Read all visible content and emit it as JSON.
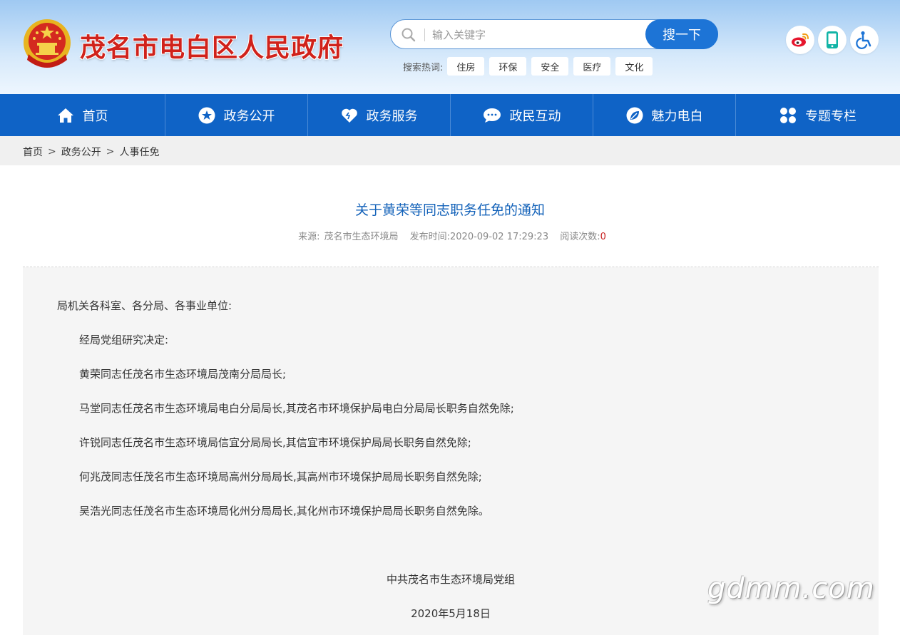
{
  "header": {
    "site_title": "茂名市电白区人民政府",
    "emblem_icon": "national-emblem-icon",
    "search": {
      "placeholder": "输入关键字",
      "button_label": "搜一下"
    },
    "hot_search": {
      "label": "搜索热词:",
      "tags": [
        "住房",
        "环保",
        "安全",
        "医疗",
        "文化"
      ]
    },
    "tools": [
      {
        "icon": "weibo-icon"
      },
      {
        "icon": "mobile-icon"
      },
      {
        "icon": "accessibility-icon"
      }
    ]
  },
  "nav": {
    "items": [
      {
        "label": "首页",
        "icon": "home-icon"
      },
      {
        "label": "政务公开",
        "icon": "star-icon"
      },
      {
        "label": "政务服务",
        "icon": "heart-icon"
      },
      {
        "label": "政民互动",
        "icon": "chat-icon"
      },
      {
        "label": "魅力电白",
        "icon": "leaf-icon"
      },
      {
        "label": "专题专栏",
        "icon": "grid-icon"
      }
    ]
  },
  "breadcrumb": {
    "items": [
      "首页",
      "政务公开",
      "人事任免"
    ],
    "separator": ">"
  },
  "article": {
    "title": "关于黄荣等同志职务任免的通知",
    "source_label": "来源:",
    "source": "茂名市生态环境局",
    "time_label": "发布时间:",
    "time": "2020-09-02 17:29:23",
    "views_label": "阅读次数:",
    "views": "0",
    "salutation": "局机关各科室、各分局、各事业单位:",
    "paragraphs": [
      "经局党组研究决定:",
      "黄荣同志任茂名市生态环境局茂南分局局长;",
      "马堂同志任茂名市生态环境局电白分局局长,其茂名市环境保护局电白分局局长职务自然免除;",
      "许锐同志任茂名市生态环境局信宜分局局长,其信宜市环境保护局局长职务自然免除;",
      "何兆茂同志任茂名市生态环境局高州分局局长,其高州市环境保护局局长职务自然免除;",
      "吴浩光同志任茂名市生态环境局化州分局局长,其化州市环境保护局局长职务自然免除。"
    ],
    "signature": "中共茂名市生态环境局党组",
    "date": "2020年5月18日"
  },
  "watermark": "gdmm.com",
  "colors": {
    "nav_bg": "#0f63c6",
    "title_red": "#d0221b",
    "link_blue": "#1362b9",
    "button_blue": "#1d74d6"
  }
}
